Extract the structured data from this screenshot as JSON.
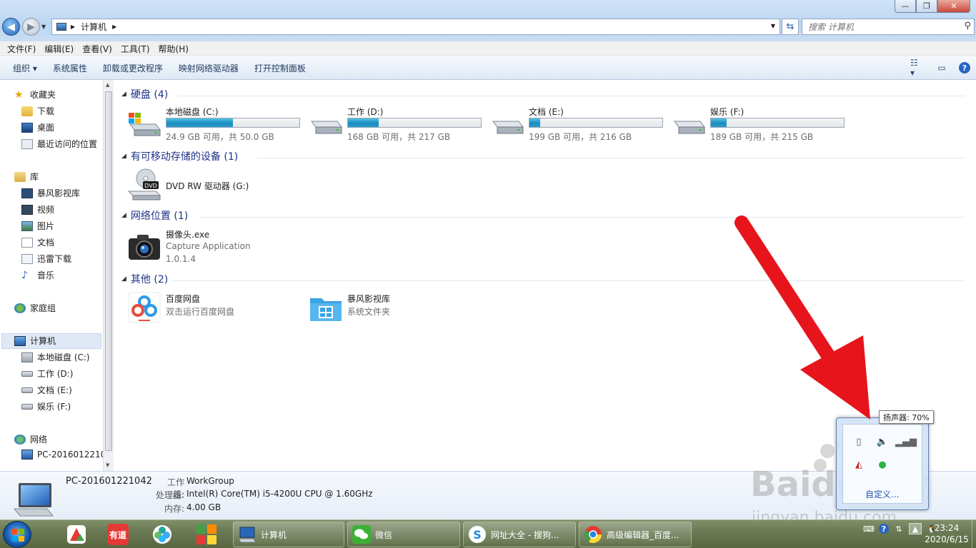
{
  "window": {
    "caption": {
      "minimize": "—",
      "maximize": "❐",
      "close": "✕"
    }
  },
  "address": {
    "crumbs": [
      "计算机"
    ],
    "separator": "▶"
  },
  "search": {
    "placeholder": "搜索 计算机"
  },
  "menubar": [
    "文件(F)",
    "编辑(E)",
    "查看(V)",
    "工具(T)",
    "帮助(H)"
  ],
  "toolbar": {
    "organize": "组织 ▾",
    "system_properties": "系统属性",
    "uninstall": "卸载或更改程序",
    "map_drive": "映射网络驱动器",
    "control_panel": "打开控制面板"
  },
  "nav": {
    "favorites": "收藏夹",
    "downloads": "下载",
    "desktop": "桌面",
    "recent": "最近访问的位置",
    "libraries": "库",
    "baofeng": "暴风影视库",
    "videos": "视频",
    "pictures": "图片",
    "documents": "文档",
    "xunlei": "迅雷下载",
    "music": "音乐",
    "homegroup": "家庭组",
    "computer": "计算机",
    "drive_c": "本地磁盘 (C:)",
    "drive_d": "工作 (D:)",
    "drive_e": "文档 (E:)",
    "drive_f": "娱乐 (F:)",
    "network": "网络",
    "pc": "PC-2016012210"
  },
  "groups": {
    "hdd": "硬盘 (4)",
    "removable": "有可移动存储的设备 (1)",
    "network": "网络位置 (1)",
    "other": "其他 (2)"
  },
  "drives": [
    {
      "name": "本地磁盘 (C:)",
      "free": "24.9 GB 可用，共 50.0 GB",
      "used_fraction": 0.5
    },
    {
      "name": "工作 (D:)",
      "free": "168 GB 可用，共 217 GB",
      "used_fraction": 0.23
    },
    {
      "name": "文档 (E:)",
      "free": "199 GB 可用，共 216 GB",
      "used_fraction": 0.08
    },
    {
      "name": "娱乐 (F:)",
      "free": "189 GB 可用，共 215 GB",
      "used_fraction": 0.12
    }
  ],
  "dvd": {
    "name": "DVD RW 驱动器 (G:)",
    "badge": "DVD"
  },
  "camera": {
    "name": "摄像头.exe",
    "desc": "Capture Application",
    "version": "1.0.1.4"
  },
  "other": [
    {
      "name": "百度网盘",
      "desc": "双击运行百度网盘"
    },
    {
      "name": "暴风影视库",
      "desc": "系统文件夹"
    }
  ],
  "details": {
    "pc_name": "PC-201601221042",
    "workgroup_label": "工作组:",
    "workgroup": "WorkGroup",
    "cpu_label": "处理器:",
    "cpu": "Intel(R) Core(TM) i5-4200U CPU @ 1.60GHz",
    "ram_label": "内存:",
    "ram": "4.00 GB"
  },
  "tray_popup": {
    "tooltip": "扬声器: 70%",
    "customize": "自定义..."
  },
  "taskbar": {
    "pins": {
      "youdao": "有道"
    },
    "tasks": [
      "计算机",
      "微信",
      "网址大全 - 搜狗...",
      "高级编辑器_百度..."
    ],
    "clock_time": "23:24",
    "clock_date": "2020/6/15"
  },
  "watermark": {
    "brand": "Baidu经验",
    "url": "jingyan.baidu.com"
  },
  "colors": {
    "accent": "#1e3287",
    "bar_fill": "#1b8cc0",
    "arrow": "#e8141c",
    "taskbar": "#6b7a55"
  },
  "icons": [
    "back-arrow-icon",
    "forward-arrow-icon",
    "computer-icon",
    "refresh-icon",
    "search-icon",
    "star-icon",
    "folder-icon",
    "drive-icon",
    "dvd-icon",
    "camera-icon",
    "baidu-netdisk-icon",
    "speaker-icon"
  ]
}
